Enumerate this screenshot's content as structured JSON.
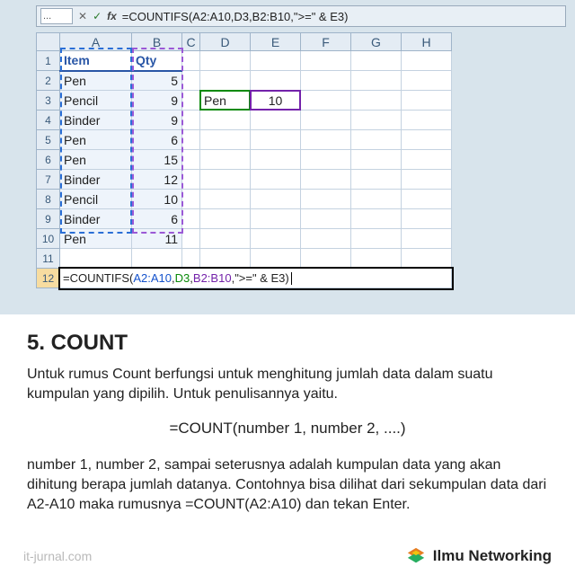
{
  "excel": {
    "formula_bar_text": "=COUNTIFS(A2:A10,D3,B2:B10,\">=\" & E3)",
    "columns": [
      "A",
      "B",
      "C",
      "D",
      "E",
      "F",
      "G",
      "H"
    ],
    "headers": {
      "a1": "Item",
      "b1": "Qty"
    },
    "rows": [
      {
        "n": 2,
        "item": "Pen",
        "qty": 5
      },
      {
        "n": 3,
        "item": "Pencil",
        "qty": 9
      },
      {
        "n": 4,
        "item": "Binder",
        "qty": 9
      },
      {
        "n": 5,
        "item": "Pen",
        "qty": 6
      },
      {
        "n": 6,
        "item": "Pen",
        "qty": 15
      },
      {
        "n": 7,
        "item": "Binder",
        "qty": 12
      },
      {
        "n": 8,
        "item": "Pencil",
        "qty": 10
      },
      {
        "n": 9,
        "item": "Binder",
        "qty": 6
      },
      {
        "n": 10,
        "item": "Pen",
        "qty": 11
      }
    ],
    "criteria": {
      "d3": "Pen",
      "e3": 10
    },
    "editing_cell": {
      "row": 12,
      "prefix": "=COUNTIFS(",
      "r1": "A2:A10",
      "c1": ",",
      "r2": "D3",
      "c2": ",",
      "r3": "B2:B10",
      "c3": ",",
      "tail": "\">=\" & E3)"
    }
  },
  "article": {
    "heading": "5. COUNT",
    "p1": "Untuk rumus Count berfungsi untuk menghitung jumlah data dalam suatu kumpulan yang dipilih. Untuk penulisannya yaitu.",
    "formula": "=COUNT(number 1, number 2, ....)",
    "p2": "number 1, number 2, sampai seterusnya adalah kumpulan data yang akan dihitung berapa jumlah datanya. Contohnya bisa dilihat dari sekumpulan data dari A2-A10 maka rumusnya =COUNT(A2:A10) dan tekan Enter."
  },
  "footer": {
    "source": "it-jurnal.com",
    "brand": "Ilmu Networking"
  }
}
